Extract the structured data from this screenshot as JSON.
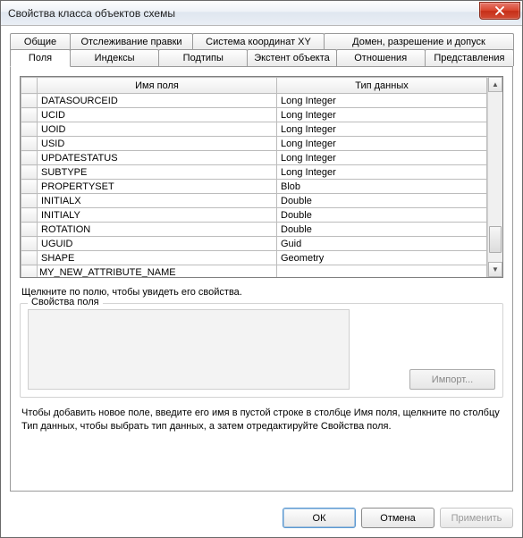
{
  "window": {
    "title": "Свойства класса объектов схемы"
  },
  "tabs_row1": [
    {
      "label": "Общие"
    },
    {
      "label": "Отслеживание правки"
    },
    {
      "label": "Система координат XY"
    },
    {
      "label": "Домен, разрешение и допуск"
    }
  ],
  "tabs_row2": [
    {
      "label": "Поля",
      "active": true
    },
    {
      "label": "Индексы"
    },
    {
      "label": "Подтипы"
    },
    {
      "label": "Экстент объекта"
    },
    {
      "label": "Отношения"
    },
    {
      "label": "Представления"
    }
  ],
  "grid": {
    "headers": {
      "name": "Имя поля",
      "type": "Тип данных"
    },
    "rows": [
      {
        "name": "DATASOURCEID",
        "type": "Long Integer"
      },
      {
        "name": "UCID",
        "type": "Long Integer"
      },
      {
        "name": "UOID",
        "type": "Long Integer"
      },
      {
        "name": "USID",
        "type": "Long Integer"
      },
      {
        "name": "UPDATESTATUS",
        "type": "Long Integer"
      },
      {
        "name": "SUBTYPE",
        "type": "Long Integer"
      },
      {
        "name": "PROPERTYSET",
        "type": "Blob"
      },
      {
        "name": "INITIALX",
        "type": "Double"
      },
      {
        "name": "INITIALY",
        "type": "Double"
      },
      {
        "name": "ROTATION",
        "type": "Double"
      },
      {
        "name": "UGUID",
        "type": "Guid"
      },
      {
        "name": "SHAPE",
        "type": "Geometry"
      }
    ],
    "editing_row": {
      "name": "MY_NEW_ATTRIBUTE_NAME",
      "type": ""
    }
  },
  "hints": {
    "click_field": "Щелкните по полю, чтобы увидеть его свойства.",
    "props_legend": "Свойства поля",
    "import": "Импорт...",
    "footer": "Чтобы добавить новое поле, введите его имя в пустой строке в столбце Имя поля, щелкните по столбцу Тип данных, чтобы выбрать тип данных, а затем отредактируйте Свойства поля."
  },
  "buttons": {
    "ok": "ОК",
    "cancel": "Отмена",
    "apply": "Применить"
  }
}
